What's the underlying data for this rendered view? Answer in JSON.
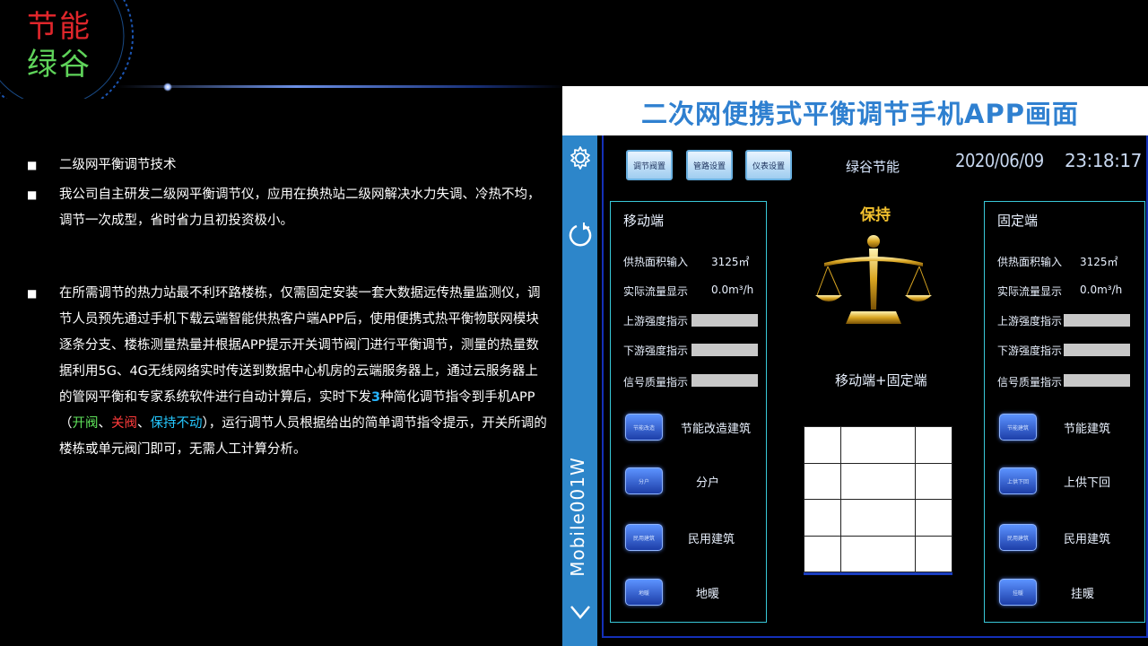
{
  "logo": {
    "line1": "节能",
    "line2": "绿谷"
  },
  "bullets": {
    "item1": "二级网平衡调节技术",
    "item2": "我公司自主研发二级网平衡调节仪，应用在换热站二级网解决水力失调、冷热不均，调节一次成型，省时省力且初投资极小。",
    "item3_part1": "在所需调节的热力站最不利环路楼栋，仅需固定安装一套大数据远传热量监测仪，调节人员预先通过手机下载云端智能供热客户端APP后，使用便携式热平衡物联网模块逐条分支、楼栋测量热量并根据APP提示开关调节阀门进行平衡调节，测量的热量数据利用5G、4G无线网络实时传送到数据中心机房的云端服务器上，通过云服务器上的管网平衡和专家系统软件进行自动计算后，实时下发",
    "item3_num": "3",
    "item3_part2": "种简化调节指令到手机APP（",
    "item3_cmd1": "开阀",
    "item3_sep1": "、",
    "item3_cmd2": "关阀",
    "item3_sep2": "、",
    "item3_cmd3": "保持不动",
    "item3_part3": "），运行调节人员根据给出的简单调节指令提示，开关所调的楼栋或单元阀门即可，无需人工计算分析。"
  },
  "app": {
    "banner_title": "二次网便携式平衡调节手机APP画面",
    "side_label": "Mobile001W",
    "top_buttons": [
      "调节阀置",
      "管路设置",
      "仪表设置"
    ],
    "brand": "绿谷节能",
    "date": "2020/06/09",
    "time": "23:18:17",
    "status": "保持",
    "mode": "移动端+固定端",
    "left_panel": {
      "title": "移动端",
      "rows": [
        {
          "label": "供热面积输入",
          "value": "3125㎡"
        },
        {
          "label": "实际流量显示",
          "value": "0.0m³/h"
        },
        {
          "label": "上游强度指示"
        },
        {
          "label": "下游强度指示"
        },
        {
          "label": "信号质量指示"
        }
      ],
      "buttons": [
        {
          "btn": "节能改造",
          "label": "节能改造建筑"
        },
        {
          "btn": "分户",
          "label": "分户"
        },
        {
          "btn": "民用建筑",
          "label": "民用建筑"
        },
        {
          "btn": "地暖",
          "label": "地暖"
        }
      ]
    },
    "right_panel": {
      "title": "固定端",
      "rows": [
        {
          "label": "供热面积输入",
          "value": "3125㎡"
        },
        {
          "label": "实际流量显示",
          "value": "0.0m³/h"
        },
        {
          "label": "上游强度指示"
        },
        {
          "label": "下游强度指示"
        },
        {
          "label": "信号质量指示"
        }
      ],
      "buttons": [
        {
          "btn": "节能建筑",
          "label": "节能建筑"
        },
        {
          "btn": "上供下回",
          "label": "上供下回"
        },
        {
          "btn": "民用建筑",
          "label": "民用建筑"
        },
        {
          "btn": "挂暖",
          "label": "挂暖"
        }
      ]
    },
    "colors": {
      "side_bar": "#2d86ca",
      "status": "#f2c12e",
      "panel_border": "#39c8d8",
      "banner_title": "#2f80d0"
    }
  }
}
